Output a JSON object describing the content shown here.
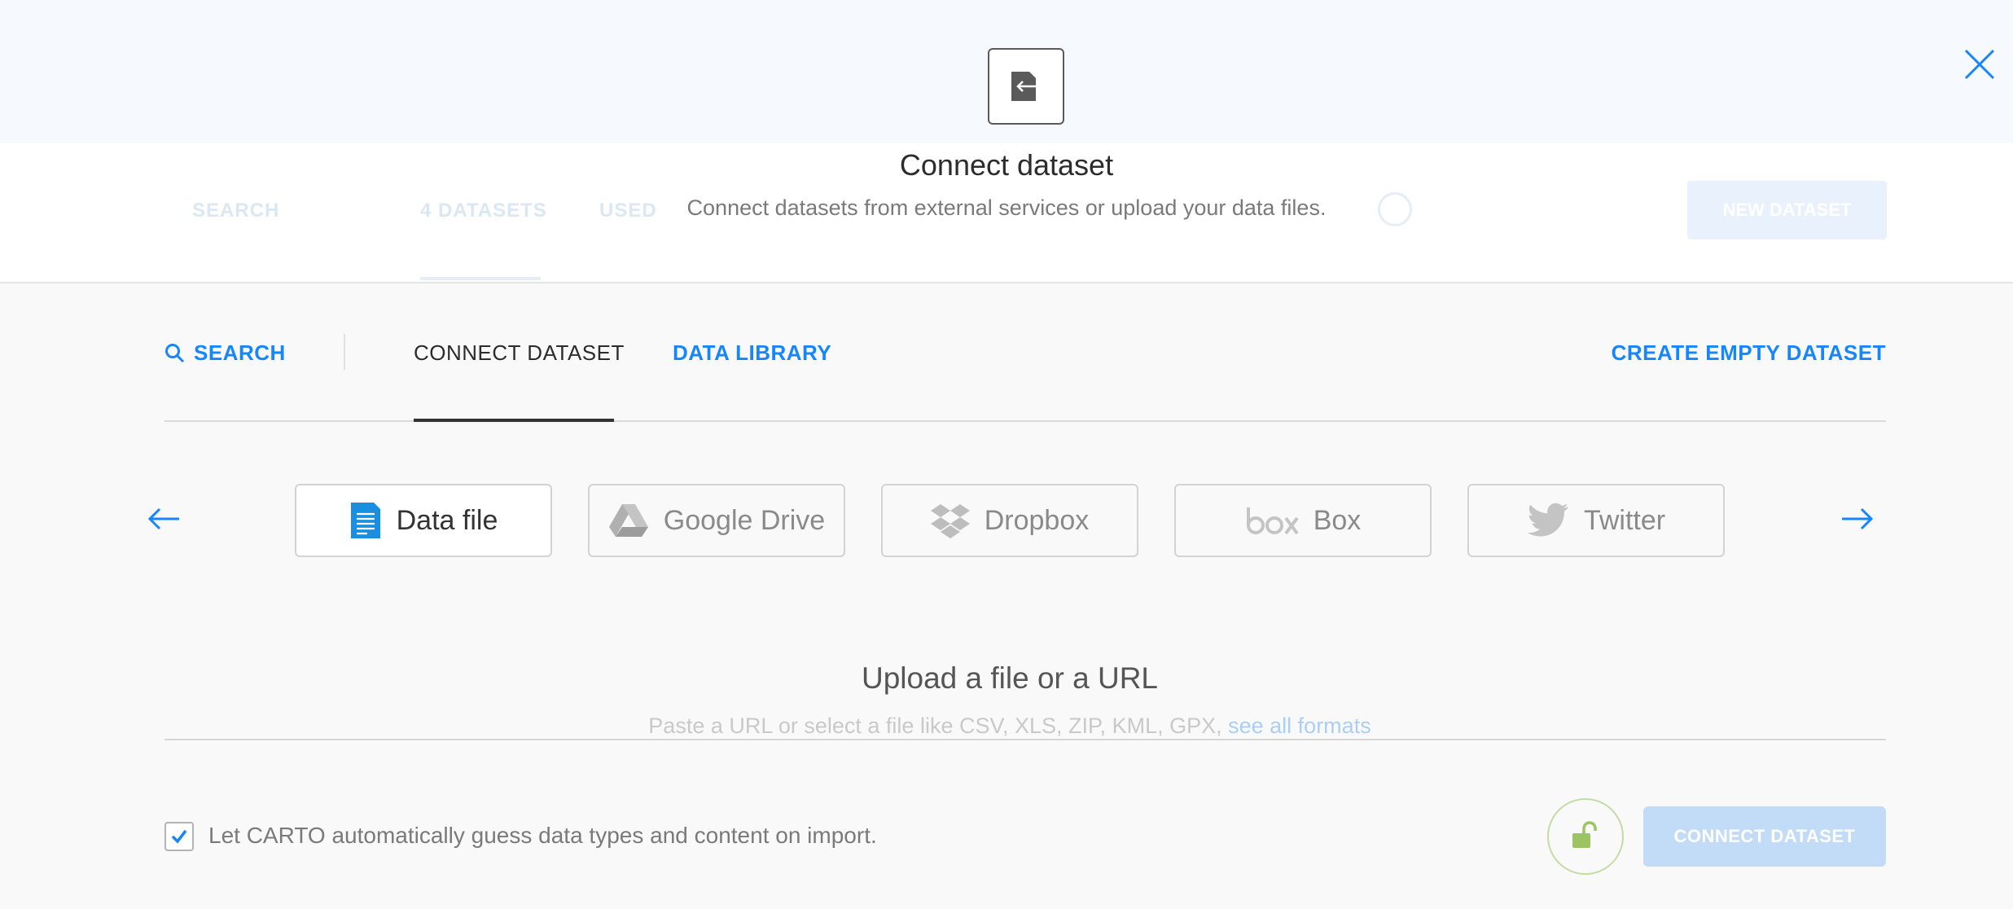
{
  "background": {
    "nav": [
      "SEARCH",
      "4 DATASETS",
      "USED"
    ],
    "new_dataset_label": "NEW DATASET"
  },
  "header": {
    "title": "Connect dataset",
    "subtitle": "Connect datasets from external services or upload your data files."
  },
  "tabs": {
    "search": "SEARCH",
    "connect": "CONNECT DATASET",
    "library": "DATA LIBRARY",
    "create": "CREATE EMPTY DATASET"
  },
  "services": [
    {
      "label": "Data file",
      "icon": "document-icon",
      "active": true
    },
    {
      "label": "Google Drive",
      "icon": "google-drive-icon",
      "active": false
    },
    {
      "label": "Dropbox",
      "icon": "dropbox-icon",
      "active": false
    },
    {
      "label": "Box",
      "icon": "box-logo-icon",
      "active": false
    },
    {
      "label": "Twitter",
      "icon": "twitter-icon",
      "active": false
    }
  ],
  "upload": {
    "title": "Upload a file or a URL",
    "hint": "Paste a URL or select a file like CSV, XLS, ZIP, KML, GPX,",
    "hint_link": "see all formats"
  },
  "footer": {
    "guess_label": "Let CARTO automatically guess data types and content on import.",
    "guess_checked": true,
    "connect_label": "CONNECT DATASET"
  },
  "colors": {
    "accent": "#1785fb",
    "disabled_button": "#c2dcf8",
    "lock": "#9cc462"
  }
}
